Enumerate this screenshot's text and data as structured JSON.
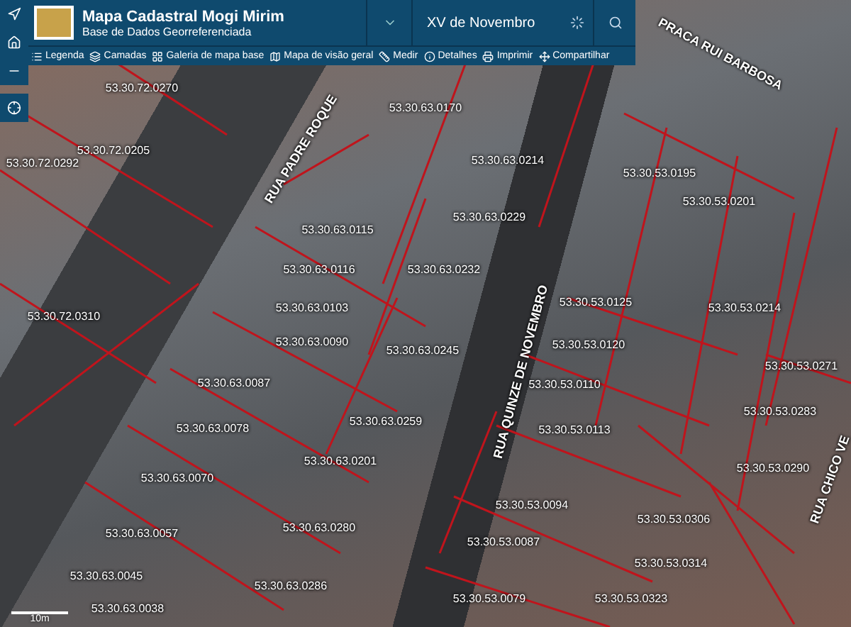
{
  "header": {
    "title": "Mapa Cadastral Mogi Mirim",
    "subtitle": "Base de Dados Georreferenciada"
  },
  "search": {
    "value": "XV de Novembro",
    "loading": true
  },
  "toolbar": [
    {
      "kind": "list",
      "label": "Legenda"
    },
    {
      "kind": "layers",
      "label": "Camadas"
    },
    {
      "kind": "grid",
      "label": "Galeria de mapa base"
    },
    {
      "kind": "overview",
      "label": "Mapa de visão geral"
    },
    {
      "kind": "ruler",
      "label": "Medir"
    },
    {
      "kind": "info",
      "label": "Detalhes"
    },
    {
      "kind": "print",
      "label": "Imprimir"
    },
    {
      "kind": "share",
      "label": "Compartilhar"
    }
  ],
  "map_controls": [
    {
      "kind": "compass"
    },
    {
      "kind": "home"
    },
    {
      "kind": "zoom-out"
    },
    {
      "kind": "locate"
    }
  ],
  "streets": [
    "RUA PADRE ROQUE",
    "PRACA RUI BARBOSA",
    "RUA QUINZE DE NOVEMBRO",
    "RUA CHICO VE"
  ],
  "parcels": [
    "53.30.72.0270",
    "53.30.72.0205",
    "53.30.72.0292",
    "53.30.72.0310",
    "53.30.63.0170",
    "53.30.63.0214",
    "53.30.63.0229",
    "53.30.63.0115",
    "53.30.63.0116",
    "53.30.63.0103",
    "53.30.63.0232",
    "53.30.63.0090",
    "53.30.63.0245",
    "53.30.63.0087",
    "53.30.63.0259",
    "53.30.63.0078",
    "53.30.63.0201",
    "53.30.63.0070",
    "53.30.63.0280",
    "53.30.63.0057",
    "53.30.63.0045",
    "53.30.63.0038",
    "53.30.63.0286",
    "53.30.53.0195",
    "53.30.53.0201",
    "53.30.53.0214",
    "53.30.53.0125",
    "53.30.53.0120",
    "53.30.53.0110",
    "53.30.53.0113",
    "53.30.53.0094",
    "53.30.53.0087",
    "53.30.53.0079",
    "53.30.53.0323",
    "53.30.53.0306",
    "53.30.53.0314",
    "53.30.53.0271",
    "53.30.53.0283",
    "53.30.53.0290"
  ],
  "scale": {
    "label": "10m"
  }
}
